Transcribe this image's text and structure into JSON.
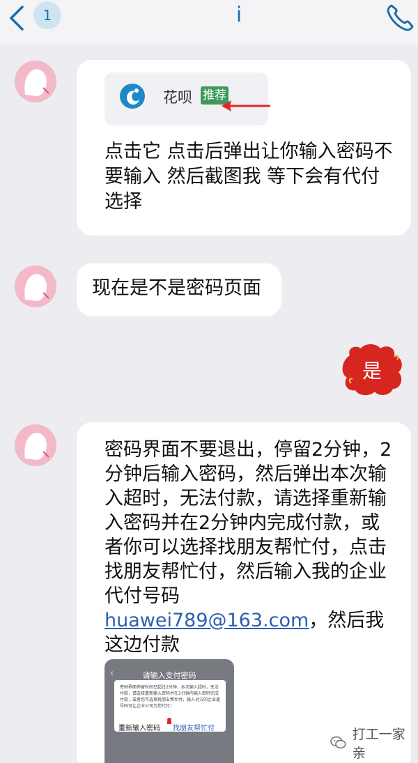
{
  "header": {
    "unread_count": "1",
    "contact_name": "i"
  },
  "messages": [
    {
      "side": "left",
      "card": {
        "app_name": "花呗",
        "tag": "推荐"
      },
      "text": "点击它 点击后弹出让你输入密码不要输入 然后截图我 等下会有代付选择"
    },
    {
      "side": "left",
      "text": "现在是不是密码页面"
    },
    {
      "side": "right",
      "text": "是"
    },
    {
      "side": "left",
      "text_before_link": "密码界面不要退出，停留2分钟，2分钟后输入密码，然后弹出本次输入超时，无法付款，请选择重新输入密码并在2分钟内完成付款，或者你可以选择找朋友帮忙付，点击找朋友帮忙付，然后输入我的企业代付号码",
      "link": "huawei789@163.com",
      "text_after_link": "，然后我这边付款",
      "embedded_screenshot": {
        "title": "请输入支付密码",
        "dialog_text": "密码界面停留时间已超过2分钟，本次输入超时，无法付款，请选择重新输入密码并在2分钟内输入密码完成付款，或者您可选择找朋友帮忙付，输入对方的企业邀号码可让企业公司为您代付！",
        "button_retry": "重新输入密码",
        "button_friend": "找朋友帮忙付"
      }
    }
  ],
  "watermark": {
    "text": "打工一家亲"
  },
  "colors": {
    "accent": "#1b6ea8",
    "tag_green": "#3d9a5a",
    "arrow_red": "#e0262b",
    "right_bubble_red": "#d7261f",
    "link_blue": "#2b5fb0"
  }
}
